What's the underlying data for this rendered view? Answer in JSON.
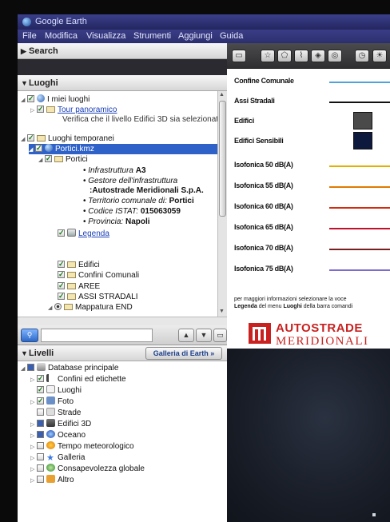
{
  "window": {
    "title": "Google Earth"
  },
  "menu": [
    "File",
    "Modifica",
    "Visualizza",
    "Strumenti",
    "Aggiungi",
    "Guida"
  ],
  "search_panel": {
    "title": "Search"
  },
  "places_panel": {
    "title": "Luoghi",
    "items": {
      "my_places": "I miei luoghi",
      "tour": "Tour panoramico",
      "tour_note": "Verifica che il livello Edifici 3D sia selezionato",
      "temp_places": "Luoghi temporanei",
      "kmz": "Portici.kmz",
      "portici": "Portici",
      "infra_label": "Infrastruttura",
      "infra_value": "A3",
      "gestore_label": "Gestore dell'infrastruttura",
      "gestore_value": ":Autostrade Meridionali S.p.A.",
      "territorio_label": "Territorio comunale di:",
      "territorio_value": "Portici",
      "istat_label": "Codice ISTAT:",
      "istat_value": "015063059",
      "provincia_label": "Provincia:",
      "provincia_value": "Napoli",
      "legenda": "Legenda",
      "edifici": "Edifici",
      "confini": "Confini Comunali",
      "aree": "AREE",
      "assi": "ASSI STRADALI",
      "mappatura": "Mappatura END"
    }
  },
  "layers_panel": {
    "title": "Livelli",
    "gallery_button": "Galleria di Earth  »",
    "items": [
      "Database principale",
      "Confini ed etichette",
      "Luoghi",
      "Foto",
      "Strade",
      "Edifici 3D",
      "Oceano",
      "Tempo meteorologico",
      "Galleria",
      "Consapevolezza globale",
      "Altro"
    ]
  },
  "legend": {
    "rows": [
      {
        "label": "Confine Comunale",
        "color": "#4fa3d9",
        "kind": "line"
      },
      {
        "label": "Assi Stradali",
        "color": "#111111",
        "kind": "line"
      },
      {
        "label": "Edifici",
        "color": "#4a4a4a",
        "kind": "square"
      },
      {
        "label": "Edifici Sensibili",
        "color": "#0d1a3d",
        "kind": "square"
      },
      {
        "label": "Isofonica 50 dB(A)",
        "color": "#e2b000",
        "kind": "line"
      },
      {
        "label": "Isofonica 55 dB(A)",
        "color": "#e07b00",
        "kind": "line"
      },
      {
        "label": "Isofonica 60 dB(A)",
        "color": "#d22b10",
        "kind": "line"
      },
      {
        "label": "Isofonica 65 dB(A)",
        "color": "#c0102a",
        "kind": "line"
      },
      {
        "label": "Isofonica 70 dB(A)",
        "color": "#7a1f1f",
        "kind": "line"
      },
      {
        "label": "Isofonica 75 dB(A)",
        "color": "#7d6bd0",
        "kind": "line"
      }
    ],
    "note_line1": "per maggiori informazioni selezionare la voce",
    "note_line2_bold": "Legenda",
    "note_line2_rest": " del menu ",
    "note_line2_bold2": "Luoghi",
    "note_line2_end": " della barra comandi",
    "logo_line1": "AUTOSTRADE",
    "logo_line2": "MERIDIONALI"
  }
}
